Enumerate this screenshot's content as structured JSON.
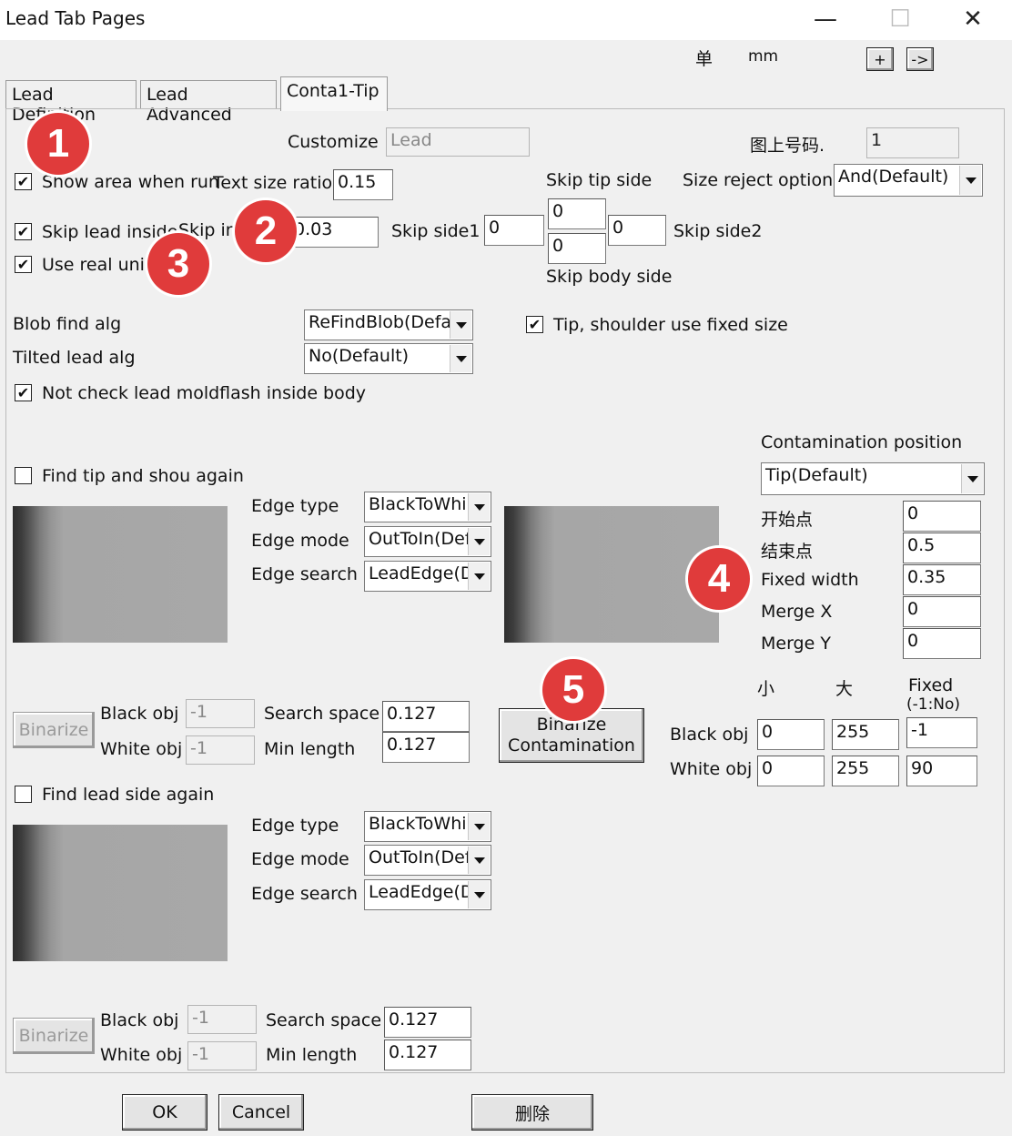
{
  "window": {
    "title": "Lead Tab Pages",
    "minimize": "—",
    "maximize": "☐",
    "close": "✕"
  },
  "unit": {
    "label": "单",
    "value": "mm",
    "plus_button": "+",
    "arrow_button": "->"
  },
  "tabs": [
    "Lead Definition",
    "Lead Advanced",
    "Conta1-Tip"
  ],
  "customize": {
    "label": "Customize",
    "value": "Lead"
  },
  "image_number": {
    "label": "图上号码.",
    "value": "1"
  },
  "show_area": {
    "label": "Show area when run",
    "checked": true
  },
  "text_size_ratio": {
    "label": "Text size ratio",
    "value": "0.15"
  },
  "skip_tip_side": {
    "label": "Skip tip side",
    "top_value": "0",
    "bottom_value": "0",
    "mid_value": "0"
  },
  "size_reject": {
    "label": "Size reject option",
    "value": "And(Default)"
  },
  "skip_lead_inside": {
    "label": "Skip lead inside",
    "checked": true
  },
  "skip_in": {
    "label": "Skip in",
    "value": "0.03"
  },
  "skip_side1": {
    "label": "Skip side1",
    "value": "0"
  },
  "skip_side2": {
    "label": "Skip side2"
  },
  "use_real_unit": {
    "label": "Use real unit",
    "checked": true
  },
  "skip_body_side": {
    "label": "Skip body side"
  },
  "blob_find": {
    "label": "Blob find alg",
    "value": "ReFindBlob(Defau"
  },
  "tip_shoulder": {
    "label": "Tip, shoulder use fixed size",
    "checked": true
  },
  "tilted_lead": {
    "label": "Tilted lead alg",
    "value": "No(Default)"
  },
  "not_check": {
    "label": "Not check  lead moldflash inside body",
    "checked": true
  },
  "find_tip": {
    "label": "Find tip and shou again",
    "checked": false
  },
  "edge1": {
    "type_label": "Edge type",
    "type_value": "BlackToWhi",
    "mode_label": "Edge mode",
    "mode_value": "OutToIn(Def",
    "search_label": "Edge search",
    "search_value": "LeadEdge(D"
  },
  "binarize1": {
    "button": "Binarize",
    "black_label": "Black obj",
    "black_value": "-1",
    "white_label": "White obj",
    "white_value": "-1",
    "space_label": "Search space",
    "space_value": "0.127",
    "min_label": "Min length",
    "min_value": "0.127"
  },
  "find_lead_side": {
    "label": "Find lead side again",
    "checked": false
  },
  "edge2": {
    "type_label": "Edge type",
    "type_value": "BlackToWhi",
    "mode_label": "Edge mode",
    "mode_value": "OutToIn(Def",
    "search_label": "Edge search",
    "search_value": "LeadEdge(D"
  },
  "binarize2": {
    "button": "Binarize",
    "black_label": "Black obj",
    "black_value": "-1",
    "white_label": "White obj",
    "white_value": "-1",
    "space_label": "Search space",
    "space_value": "0.127",
    "min_label": "Min length",
    "min_value": "0.127"
  },
  "contamination": {
    "position_label": "Contamination position",
    "position_value": "Tip(Default)",
    "start_label": "开始点",
    "start_value": "0",
    "end_label": "结束点",
    "end_value": "0.5",
    "fixed_width_label": "Fixed width",
    "fixed_width_value": "0.35",
    "merge_x_label": "Merge X",
    "merge_x_value": "0",
    "merge_y_label": "Merge Y",
    "merge_y_value": "0",
    "binarize_button_line1": "Binarize",
    "binarize_button_line2": "Contamination",
    "col_small": "小",
    "col_large": "大",
    "col_fixed_line1": "Fixed",
    "col_fixed_line2": "(-1:No)",
    "black_label": "Black obj",
    "black_small": "0",
    "black_large": "255",
    "black_fixed": "-1",
    "white_label": "White obj",
    "white_small": "0",
    "white_large": "255",
    "white_fixed": "90"
  },
  "footer": {
    "ok": "OK",
    "cancel": "Cancel",
    "delete": "删除"
  },
  "badges": [
    "1",
    "2",
    "3",
    "4",
    "5"
  ],
  "colors": {
    "badge": "#e03b3b",
    "background": "#f0f0f0"
  }
}
